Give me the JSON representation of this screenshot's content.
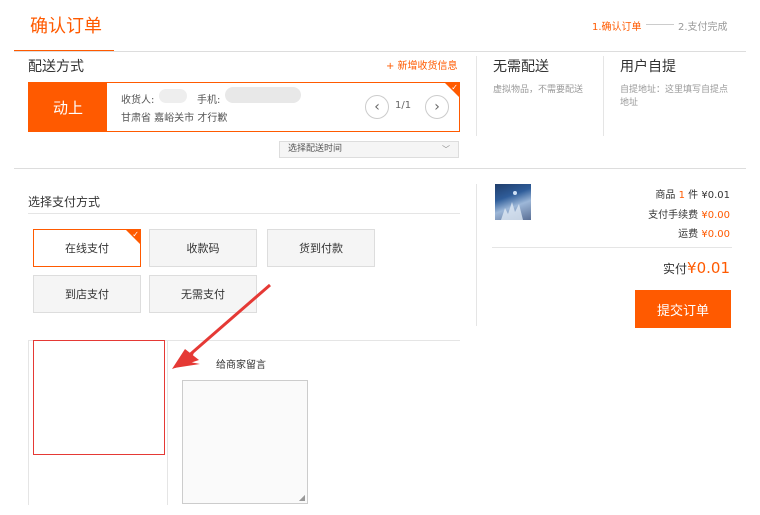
{
  "header": {
    "title": "确认订单",
    "step1": "1.确认订单",
    "step2": "2.支付完成"
  },
  "delivery": {
    "label": "配送方式",
    "add_address": "+ 新增收货信息",
    "name": "动上",
    "receiver_label": "收货人:",
    "phone_label": "手机:",
    "address": "甘肃省 嘉峪关市 才行歉",
    "page": "1/1",
    "time_select": "选择配送时间",
    "no_delivery_title": "无需配送",
    "no_delivery_desc": "虚拟物品，不需要配送",
    "pickup_title": "用户自提",
    "pickup_desc": "自提地址：这里填写自提点地址"
  },
  "payment": {
    "label": "选择支付方式",
    "options": [
      "在线支付",
      "收款码",
      "货到付款",
      "到店支付",
      "无需支付"
    ],
    "message_label": "给商家留言"
  },
  "summary": {
    "goods_label": "商品",
    "goods_count": "1",
    "goods_unit": "件",
    "goods_amount": "¥0.01",
    "fee_label": "支付手续费",
    "fee_amount": "¥0.00",
    "ship_label": "运费",
    "ship_amount": "¥0.00",
    "total_label": "实付",
    "total_amount": "¥0.01",
    "submit": "提交订单"
  },
  "colors": {
    "accent": "#ff5a00",
    "annotation": "#e53935"
  }
}
